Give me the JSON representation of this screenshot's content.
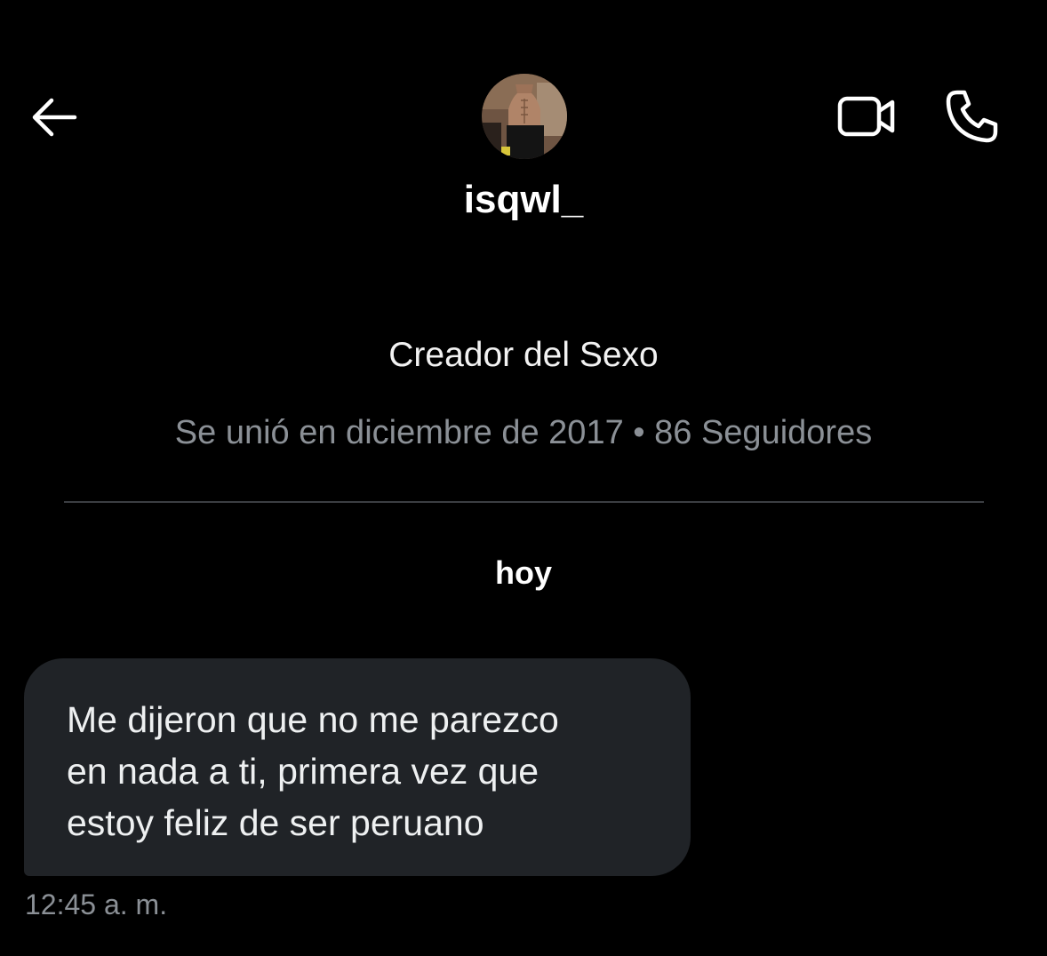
{
  "header": {
    "back_icon": "arrow-left-icon",
    "video_icon": "video-camera-icon",
    "call_icon": "phone-icon",
    "username": "isqwl_"
  },
  "profile": {
    "bio": "Creador del Sexo",
    "joined_text": "Se unió en diciembre de 2017 • 86 Seguidores"
  },
  "conversation": {
    "day_label": "hoy",
    "messages": [
      {
        "lines": [
          "Me dijeron que no me parezco",
          "en nada a ti, primera vez que",
          "estoy feliz de ser peruano"
        ],
        "time": "12:45 a. m."
      }
    ]
  },
  "colors": {
    "background": "#000000",
    "bubble": "#202327",
    "muted_text": "#8b9096",
    "divider": "#3b3e42"
  }
}
